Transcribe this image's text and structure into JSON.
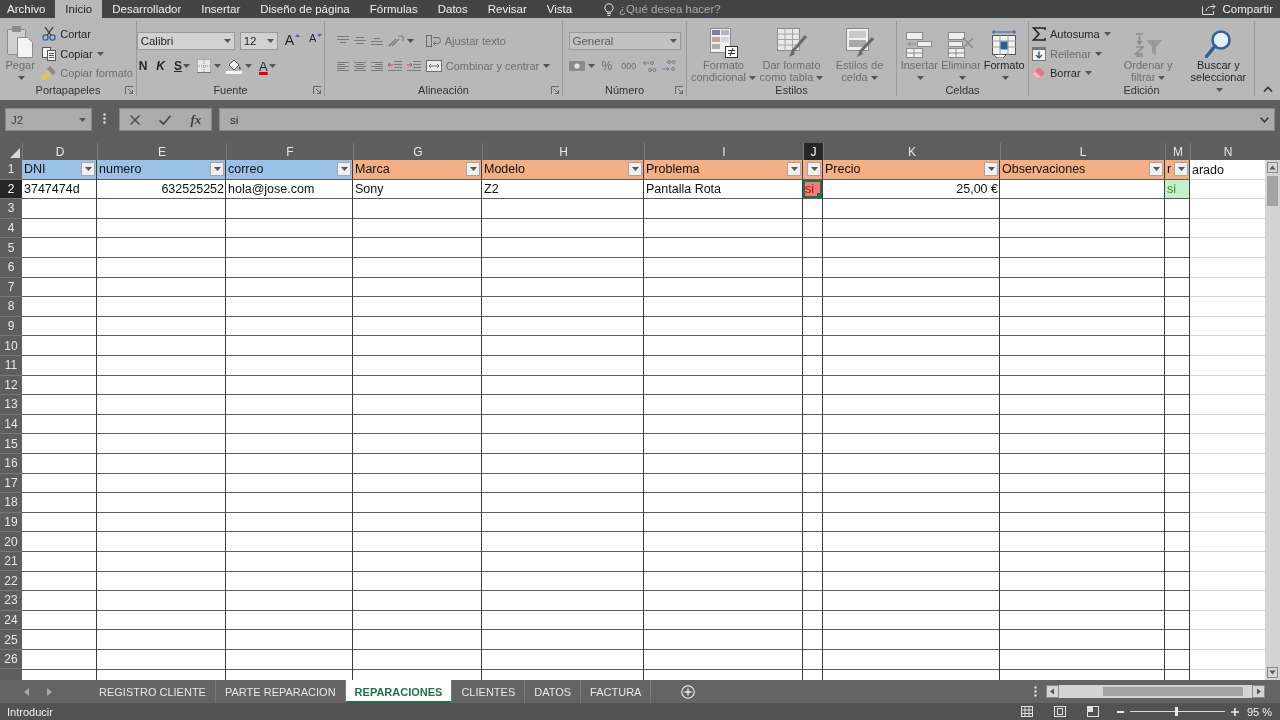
{
  "menu_tabs": [
    {
      "label": "Archivo",
      "selected": false
    },
    {
      "label": "Inicio",
      "selected": true
    },
    {
      "label": "Desarrollador",
      "selected": false
    },
    {
      "label": "Insertar",
      "selected": false
    },
    {
      "label": "Diseño de página",
      "selected": false
    },
    {
      "label": "Fórmulas",
      "selected": false
    },
    {
      "label": "Datos",
      "selected": false
    },
    {
      "label": "Revisar",
      "selected": false
    },
    {
      "label": "Vista",
      "selected": false
    }
  ],
  "tell_me": {
    "placeholder": "¿Qué desea hacer?"
  },
  "share_button": {
    "label": "Compartir"
  },
  "ribbon": {
    "groups": [
      {
        "label": "Portapapeles",
        "launcher": true,
        "cols": [
          [
            [
              {
                "kind": "large",
                "label": "Pegar",
                "caret": true,
                "disabled": true
              }
            ]
          ],
          [
            [
              {
                "kind": "small",
                "label": "Cortar",
                "disabled": false
              }
            ],
            [
              {
                "kind": "small",
                "label": "Copiar",
                "caret": true,
                "disabled": false
              }
            ],
            [
              {
                "kind": "small",
                "label": "Copiar formato",
                "disabled": true
              }
            ]
          ]
        ]
      },
      {
        "label": "Fuente",
        "launcher": true,
        "cols": [
          [
            [
              {
                "kind": "field",
                "value": "Calibri",
                "disabled": false
              },
              {
                "kind": "field",
                "value": "12",
                "disabled": false
              },
              {
                "kind": "glyph",
                "text": "A",
                "disabled": false
              },
              {
                "kind": "glyph",
                "text": "A",
                "disabled": false
              }
            ],
            [
              {
                "kind": "glyph",
                "text": "N",
                "disabled": false
              },
              {
                "kind": "glyph",
                "text": "K",
                "disabled": false
              },
              {
                "kind": "glyph",
                "text": "S",
                "caret": true,
                "disabled": false
              },
              {
                "kind": "icon",
                "caret": true,
                "disabled": true
              },
              {
                "kind": "icon",
                "caret": true,
                "disabled": false
              },
              {
                "kind": "glyph",
                "text": "A",
                "caret": true,
                "disabled": false
              }
            ]
          ]
        ]
      },
      {
        "label": "Alineación",
        "launcher": true,
        "cols": [
          [
            [
              {
                "kind": "icon",
                "disabled": true
              },
              {
                "kind": "icon",
                "disabled": true
              },
              {
                "kind": "icon",
                "disabled": true
              },
              {
                "kind": "icon",
                "caret": true,
                "disabled": true
              }
            ],
            [
              {
                "kind": "icon",
                "disabled": true
              },
              {
                "kind": "icon",
                "disabled": true
              },
              {
                "kind": "icon",
                "disabled": true
              },
              {
                "kind": "icon",
                "disabled": true
              },
              {
                "kind": "icon",
                "disabled": true
              }
            ]
          ],
          [
            [
              {
                "kind": "small",
                "label": "Ajustar texto",
                "disabled": true
              }
            ],
            [
              {
                "kind": "small",
                "label": "Combinar y centrar",
                "caret": true,
                "disabled": true
              }
            ]
          ]
        ]
      },
      {
        "label": "Número",
        "launcher": true,
        "cols": [
          [
            [
              {
                "kind": "field",
                "value": "General",
                "disabled": true
              }
            ],
            [
              {
                "kind": "icon",
                "caret": true,
                "disabled": true
              },
              {
                "kind": "glyph",
                "text": "%",
                "disabled": true
              },
              {
                "kind": "glyph",
                "text": "000",
                "disabled": true
              },
              {
                "kind": "icon",
                "disabled": true
              },
              {
                "kind": "icon",
                "disabled": true
              }
            ]
          ]
        ]
      },
      {
        "label": "Estilos",
        "cols": [
          [
            [
              {
                "kind": "large",
                "label": "Formato condicional",
                "caret": true,
                "disabled": true
              }
            ]
          ],
          [
            [
              {
                "kind": "large",
                "label": "Dar formato como tabla",
                "caret": true,
                "disabled": true
              }
            ]
          ],
          [
            [
              {
                "kind": "large",
                "label": "Estilos de celda",
                "caret": true,
                "disabled": true
              }
            ]
          ]
        ]
      },
      {
        "label": "Celdas",
        "cols": [
          [
            [
              {
                "kind": "large",
                "label": "Insertar",
                "caret": true,
                "disabled": true
              }
            ]
          ],
          [
            [
              {
                "kind": "large",
                "label": "Eliminar",
                "caret": true,
                "disabled": true
              }
            ]
          ],
          [
            [
              {
                "kind": "large",
                "label": "Formato",
                "caret": true,
                "disabled": false
              }
            ]
          ]
        ]
      },
      {
        "label": "Edición",
        "cols": [
          [
            [
              {
                "kind": "small",
                "label": "Autosuma",
                "caret": true,
                "disabled": false
              }
            ],
            [
              {
                "kind": "small",
                "label": "Rellenar",
                "caret": true,
                "disabled": true
              }
            ],
            [
              {
                "kind": "small",
                "label": "Borrar",
                "caret": true,
                "disabled": false
              }
            ]
          ],
          [
            [
              {
                "kind": "large",
                "label": "Ordenar y filtrar",
                "caret": true,
                "disabled": true
              }
            ]
          ],
          [
            [
              {
                "kind": "large",
                "label": "Buscar y seleccionar",
                "caret": true,
                "disabled": false
              }
            ]
          ]
        ]
      }
    ]
  },
  "formula_bar": {
    "name_box": "J2",
    "function_button": "fx",
    "value": "si"
  },
  "sheet": {
    "columns": [
      {
        "letter": "D",
        "selected": false
      },
      {
        "letter": "E",
        "selected": false
      },
      {
        "letter": "F",
        "selected": false
      },
      {
        "letter": "G",
        "selected": false
      },
      {
        "letter": "H",
        "selected": false
      },
      {
        "letter": "I",
        "selected": false
      },
      {
        "letter": "J",
        "selected": true
      },
      {
        "letter": "K",
        "selected": false
      },
      {
        "letter": "L",
        "selected": false
      },
      {
        "letter": "M",
        "selected": false
      },
      {
        "letter": "N",
        "selected": false
      }
    ],
    "rows": [
      {
        "number": "1",
        "selected": false,
        "cells": [
          {
            "kind": "header",
            "text": "DNI",
            "filter": true,
            "color": "#9bc2e6",
            "selected": false
          },
          {
            "kind": "header",
            "text": "numero",
            "filter": true,
            "color": "#9bc2e6",
            "selected": false
          },
          {
            "kind": "header",
            "text": "correo",
            "filter": true,
            "color": "#9bc2e6",
            "selected": false
          },
          {
            "kind": "header",
            "text": "Marca",
            "filter": true,
            "color": "#f4b084",
            "selected": false
          },
          {
            "kind": "header",
            "text": "Modelo",
            "filter": true,
            "color": "#f4b084",
            "selected": false
          },
          {
            "kind": "header",
            "text": "Problema",
            "filter": true,
            "color": "#f4b084",
            "selected": false
          },
          {
            "kind": "header",
            "filter": true,
            "color": "#f4b084",
            "selected": false
          },
          {
            "kind": "header",
            "text": "Precio",
            "filter": true,
            "color": "#f4b084",
            "selected": false
          },
          {
            "kind": "header",
            "text": "Observaciones",
            "filter": true,
            "color": "#f4b084",
            "selected": false
          },
          {
            "kind": "header",
            "text": "r",
            "overflow": "arado",
            "filter": true,
            "color": "#f4b084",
            "selected": false
          },
          {
            "kind": "blank",
            "selected": false
          }
        ]
      },
      {
        "number": "2",
        "selected": true,
        "cells": [
          {
            "kind": "text",
            "text": "3747474d",
            "selected": false
          },
          {
            "kind": "number",
            "text": "632525252",
            "selected": false
          },
          {
            "kind": "text",
            "text": "hola@jose.com",
            "selected": false
          },
          {
            "kind": "text",
            "text": "Sony",
            "selected": false
          },
          {
            "kind": "text",
            "text": "Z2",
            "selected": false
          },
          {
            "kind": "text",
            "text": "Pantalla Rota",
            "selected": false
          },
          {
            "kind": "text",
            "text": "si",
            "color": "#f4797b",
            "selected": true
          },
          {
            "kind": "number",
            "text": "25,00 €",
            "selected": false
          },
          {
            "kind": "blank",
            "selected": false
          },
          {
            "kind": "text",
            "text": "si",
            "color": "#c6efce",
            "selected": false
          },
          {
            "kind": "blank",
            "selected": false
          }
        ]
      },
      {
        "number": "3",
        "selected": false
      },
      {
        "number": "4",
        "selected": false
      },
      {
        "number": "5",
        "selected": false
      },
      {
        "number": "6",
        "selected": false
      },
      {
        "number": "7",
        "selected": false
      },
      {
        "number": "8",
        "selected": false
      },
      {
        "number": "9",
        "selected": false
      },
      {
        "number": "10",
        "selected": false
      },
      {
        "number": "11",
        "selected": false
      },
      {
        "number": "12",
        "selected": false
      },
      {
        "number": "13",
        "selected": false
      },
      {
        "number": "14",
        "selected": false
      },
      {
        "number": "15",
        "selected": false
      },
      {
        "number": "16",
        "selected": false
      },
      {
        "number": "17",
        "selected": false
      },
      {
        "number": "18",
        "selected": false
      },
      {
        "number": "19",
        "selected": false
      },
      {
        "number": "20",
        "selected": false
      },
      {
        "number": "21",
        "selected": false
      },
      {
        "number": "22",
        "selected": false
      },
      {
        "number": "23",
        "selected": false
      },
      {
        "number": "24",
        "selected": false
      },
      {
        "number": "25",
        "selected": false
      },
      {
        "number": "26",
        "selected": false
      }
    ]
  },
  "sheet_tabs": [
    {
      "label": "REGISTRO CLIENTE",
      "selected": false
    },
    {
      "label": "PARTE REPARACION",
      "selected": false
    },
    {
      "label": "REPARACIONES",
      "selected": true
    },
    {
      "label": "CLIENTES",
      "selected": false
    },
    {
      "label": "DATOS",
      "selected": false
    },
    {
      "label": "FACTURA",
      "selected": false
    }
  ],
  "status_bar": {
    "mode": "Introducir",
    "zoom": {
      "level": 0.48,
      "reading": "95 %"
    }
  }
}
